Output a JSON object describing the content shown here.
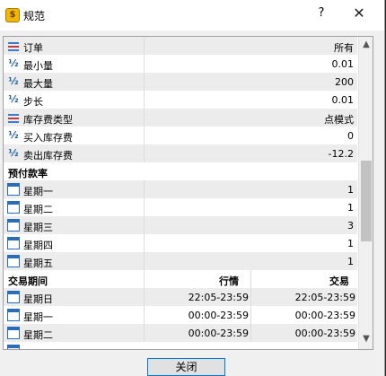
{
  "window": {
    "title": "规范",
    "help": "?",
    "close": "✕"
  },
  "rows": [
    {
      "icon": "lines-icon",
      "label": "订单",
      "value": "所有"
    },
    {
      "icon": "half-icon",
      "label": "最小量",
      "value": "0.01"
    },
    {
      "icon": "half-icon",
      "label": "最大量",
      "value": "200"
    },
    {
      "icon": "half-icon",
      "label": "步长",
      "value": "0.01"
    },
    {
      "icon": "lines-icon",
      "label": "库存费类型",
      "value": "点模式"
    },
    {
      "icon": "half-icon",
      "label": "买入库存费",
      "value": "0"
    },
    {
      "icon": "half-icon",
      "label": "卖出库存费",
      "value": "-12.2"
    }
  ],
  "margin_section": {
    "title": "预付款率"
  },
  "margin_rows": [
    {
      "label": "星期一",
      "value": "1"
    },
    {
      "label": "星期二",
      "value": "1"
    },
    {
      "label": "星期三",
      "value": "3"
    },
    {
      "label": "星期四",
      "value": "1"
    },
    {
      "label": "星期五",
      "value": "1"
    }
  ],
  "sessions_section": {
    "title": "交易期间",
    "col1": "行情",
    "col2": "交易"
  },
  "session_rows": [
    {
      "label": "星期日",
      "quotes": "22:05-23:59",
      "trade": "22:05-23:59"
    },
    {
      "label": "星期一",
      "quotes": "00:00-23:59",
      "trade": "00:00-23:59"
    },
    {
      "label": "星期二",
      "quotes": "00:00-23:59",
      "trade": "00:00-23:59"
    }
  ],
  "scroll": {
    "up": "▲",
    "down": "▼"
  },
  "footer": {
    "close_label": "关闭"
  }
}
